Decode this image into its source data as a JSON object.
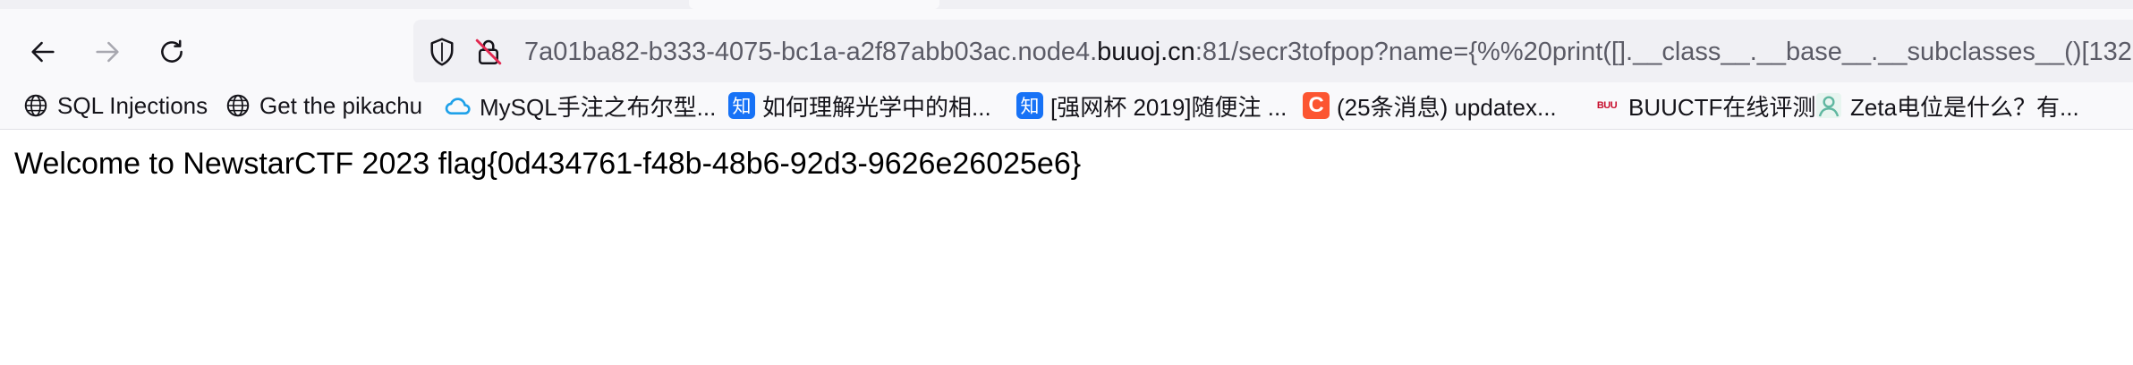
{
  "browser": {
    "url": {
      "prefix": "7a01ba82-b333-4075-bc1a-a2f87abb03ac.node4.",
      "domain": "buuoj.cn",
      "suffix": ":81/secr3tofpop?name={%%20print([].__class__.__base__.__subclasses__()[132"
    }
  },
  "bookmarks": [
    {
      "label": "SQL Injections",
      "icon": "globe-icon"
    },
    {
      "label": "Get the pikachu",
      "icon": "globe-icon"
    },
    {
      "label": "MySQL手注之布尔型...",
      "icon": "cloud-icon"
    },
    {
      "label": "如何理解光学中的相...",
      "icon": "zhihu-icon",
      "icon_text": "知"
    },
    {
      "label": "[强网杯 2019]随便注 ...",
      "icon": "zhihu-icon",
      "icon_text": "知"
    },
    {
      "label": "(25条消息) updatex...",
      "icon": "csdn-icon",
      "icon_text": "C"
    },
    {
      "label": "BUUCTF在线评测",
      "icon": "buuctf-icon",
      "icon_text": "BUU"
    },
    {
      "label": "Zeta电位是什么？有...",
      "icon": "person-icon"
    }
  ],
  "page": {
    "text": "Welcome to NewstarCTF 2023 flag{0d434761-f48b-48b6-92d3-9626e26025e6}"
  },
  "colors": {
    "zhihu": "#1772f6",
    "csdn": "#fc5531",
    "cloud": "#1fa1e9",
    "buuctf": "#c8102e",
    "zeta": "#5fb7a0"
  }
}
